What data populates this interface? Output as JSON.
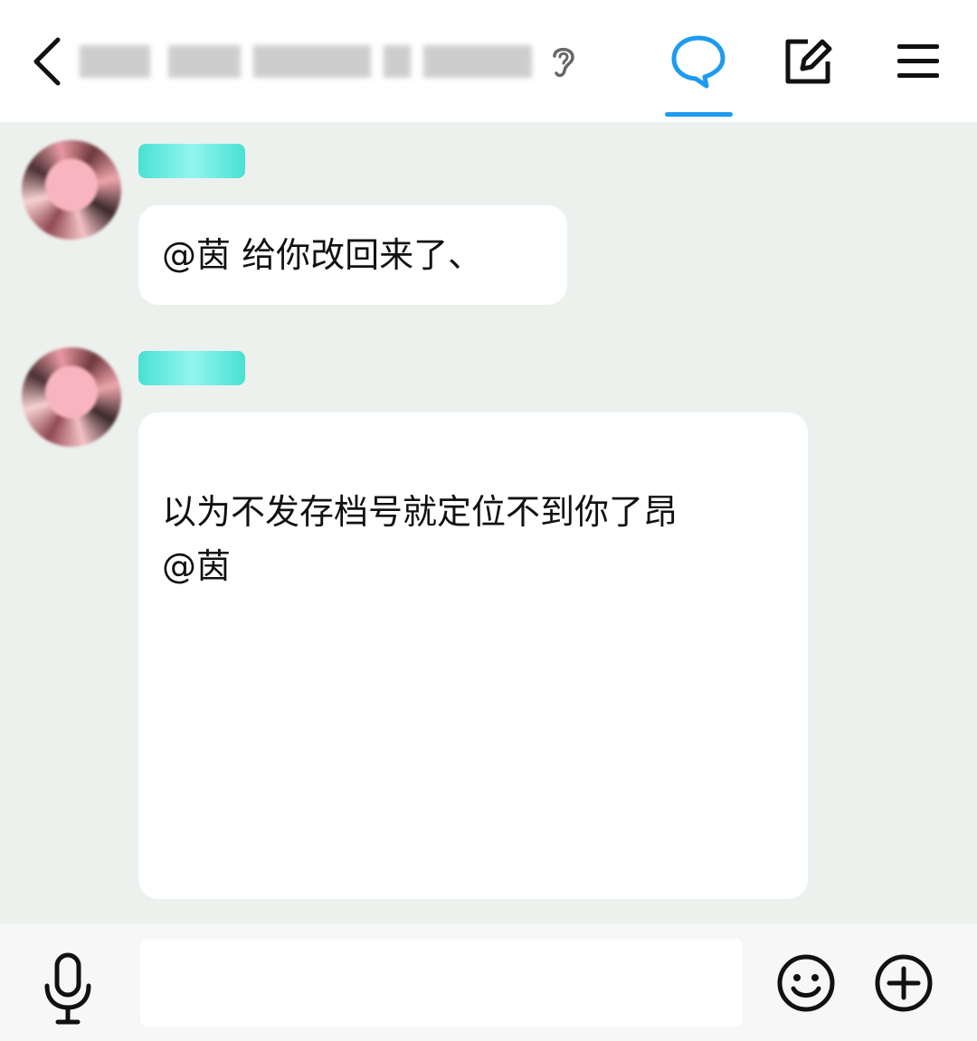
{
  "header": {
    "back_icon": "chevron-left-icon",
    "title_blurred": true,
    "ear_icon": "ear-icon",
    "chat_icon": "chat-bubble-icon",
    "compose_icon": "edit-square-icon",
    "menu_icon": "hamburger-menu-icon",
    "active_tab_color": "#1c9bf0"
  },
  "messages": [
    {
      "avatar": "avatar-pixelated",
      "nick_badge": "teal",
      "text": "@茵 给你改回来了、"
    },
    {
      "avatar": "avatar-pixelated",
      "nick_badge": "teal",
      "text": "以为不发存档号就定位不到你了昂\n@茵"
    }
  ],
  "inputbar": {
    "mic_icon": "microphone-icon",
    "input_value": "",
    "emoji_icon": "smiley-icon",
    "plus_icon": "plus-circle-icon"
  },
  "colors": {
    "chat_bg": "#edf1ee",
    "bubble_bg": "#ffffff",
    "badge": "#3fe0d0"
  }
}
